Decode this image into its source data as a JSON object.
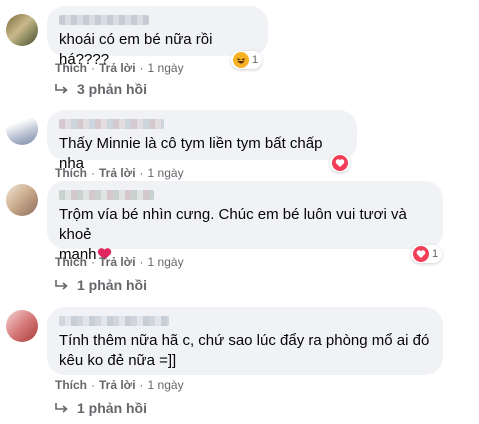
{
  "comments": [
    {
      "text": "khoái có em bé nữa rồi há????",
      "like": "Thích",
      "reply": "Trả lời",
      "time": "1 ngày",
      "reaction_count": "1",
      "reaction_icon": "haha-icon",
      "replies": "3 phản hồi"
    },
    {
      "text": "Thấy Minnie là cô tym liền tym bất chấp nha",
      "like": "Thích",
      "reply": "Trả lời",
      "time": "1 ngày",
      "reaction_icon": "love-icon"
    },
    {
      "text_line1": "Trộm vía bé nhìn cưng. Chúc em bé luôn vui tươi và khoẻ",
      "text_line2": "mạnh",
      "like": "Thích",
      "reply": "Trả lời",
      "time": "1 ngày",
      "reaction_count": "1",
      "reaction_icon": "love-icon",
      "replies": "1 phản hồi"
    },
    {
      "text_line1": "Tính thêm nữa hã c, chứ sao lúc đẩy ra phòng mổ ai đó",
      "text_line2": "kêu ko đẻ nữa =]]",
      "like": "Thích",
      "reply": "Trả lời",
      "time": "1 ngày",
      "replies": "1 phản hồi"
    }
  ],
  "separator": "·",
  "colors": {
    "bubble": "#f0f2f5",
    "meta_text": "#65676b",
    "love": "#f33e58",
    "haha": "#f7b125"
  }
}
